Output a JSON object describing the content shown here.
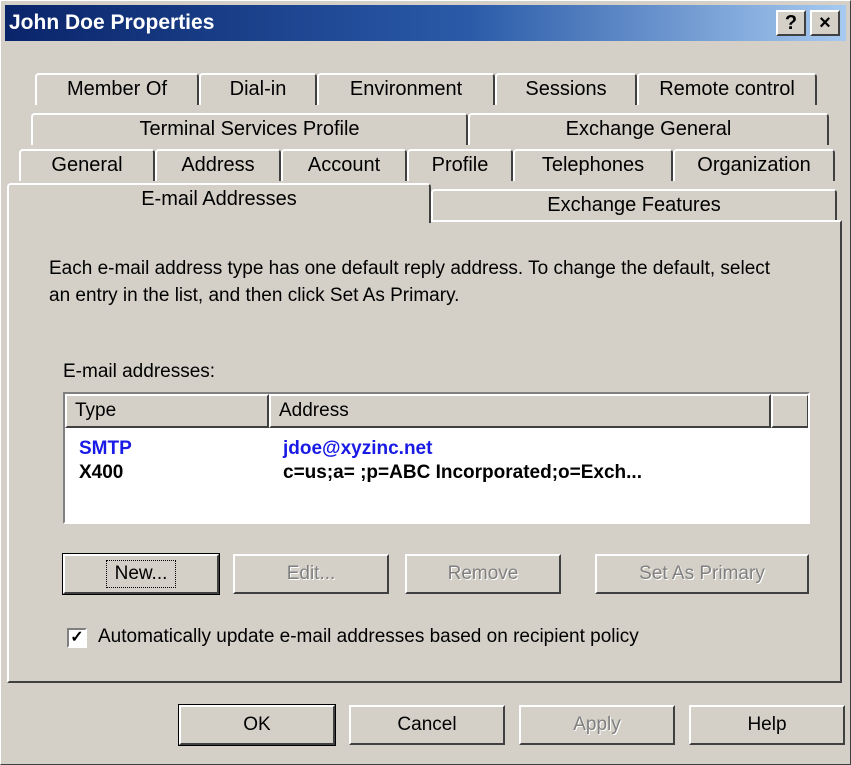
{
  "window": {
    "title": "John Doe Properties",
    "help_glyph": "?",
    "close_glyph": "×"
  },
  "tabs": {
    "row1": [
      "Member Of",
      "Dial-in",
      "Environment",
      "Sessions",
      "Remote control"
    ],
    "row2": [
      "Terminal Services Profile",
      "Exchange General"
    ],
    "row3": [
      "General",
      "Address",
      "Account",
      "Profile",
      "Telephones",
      "Organization"
    ],
    "row4": [
      "E-mail Addresses",
      "Exchange Features"
    ],
    "active": "E-mail Addresses"
  },
  "panel": {
    "description": "Each e-mail address type has one default reply address. To change the default, select an entry in the list, and then click Set As Primary.",
    "list_label": "E-mail addresses:",
    "columns": [
      "Type",
      "Address"
    ],
    "rows": [
      {
        "type": "SMTP",
        "address": "jdoe@xyzinc.net",
        "color": "#1a1ae6"
      },
      {
        "type": "X400",
        "address": "c=us;a= ;p=ABC Incorporated;o=Exch...",
        "color": "#000000"
      }
    ],
    "buttons": {
      "new": "New...",
      "edit": "Edit...",
      "remove": "Remove",
      "set_primary": "Set As Primary"
    },
    "checkbox": {
      "checked": true,
      "check_glyph": "✓",
      "label": "Automatically update e-mail addresses based on recipient policy"
    }
  },
  "footer": {
    "ok": "OK",
    "cancel": "Cancel",
    "apply": "Apply",
    "help": "Help"
  },
  "colors": {
    "face": "#d4d0c8",
    "titlebar_start": "#0a246a",
    "titlebar_end": "#a6caf0",
    "smtp_text": "#1a1ae6"
  }
}
